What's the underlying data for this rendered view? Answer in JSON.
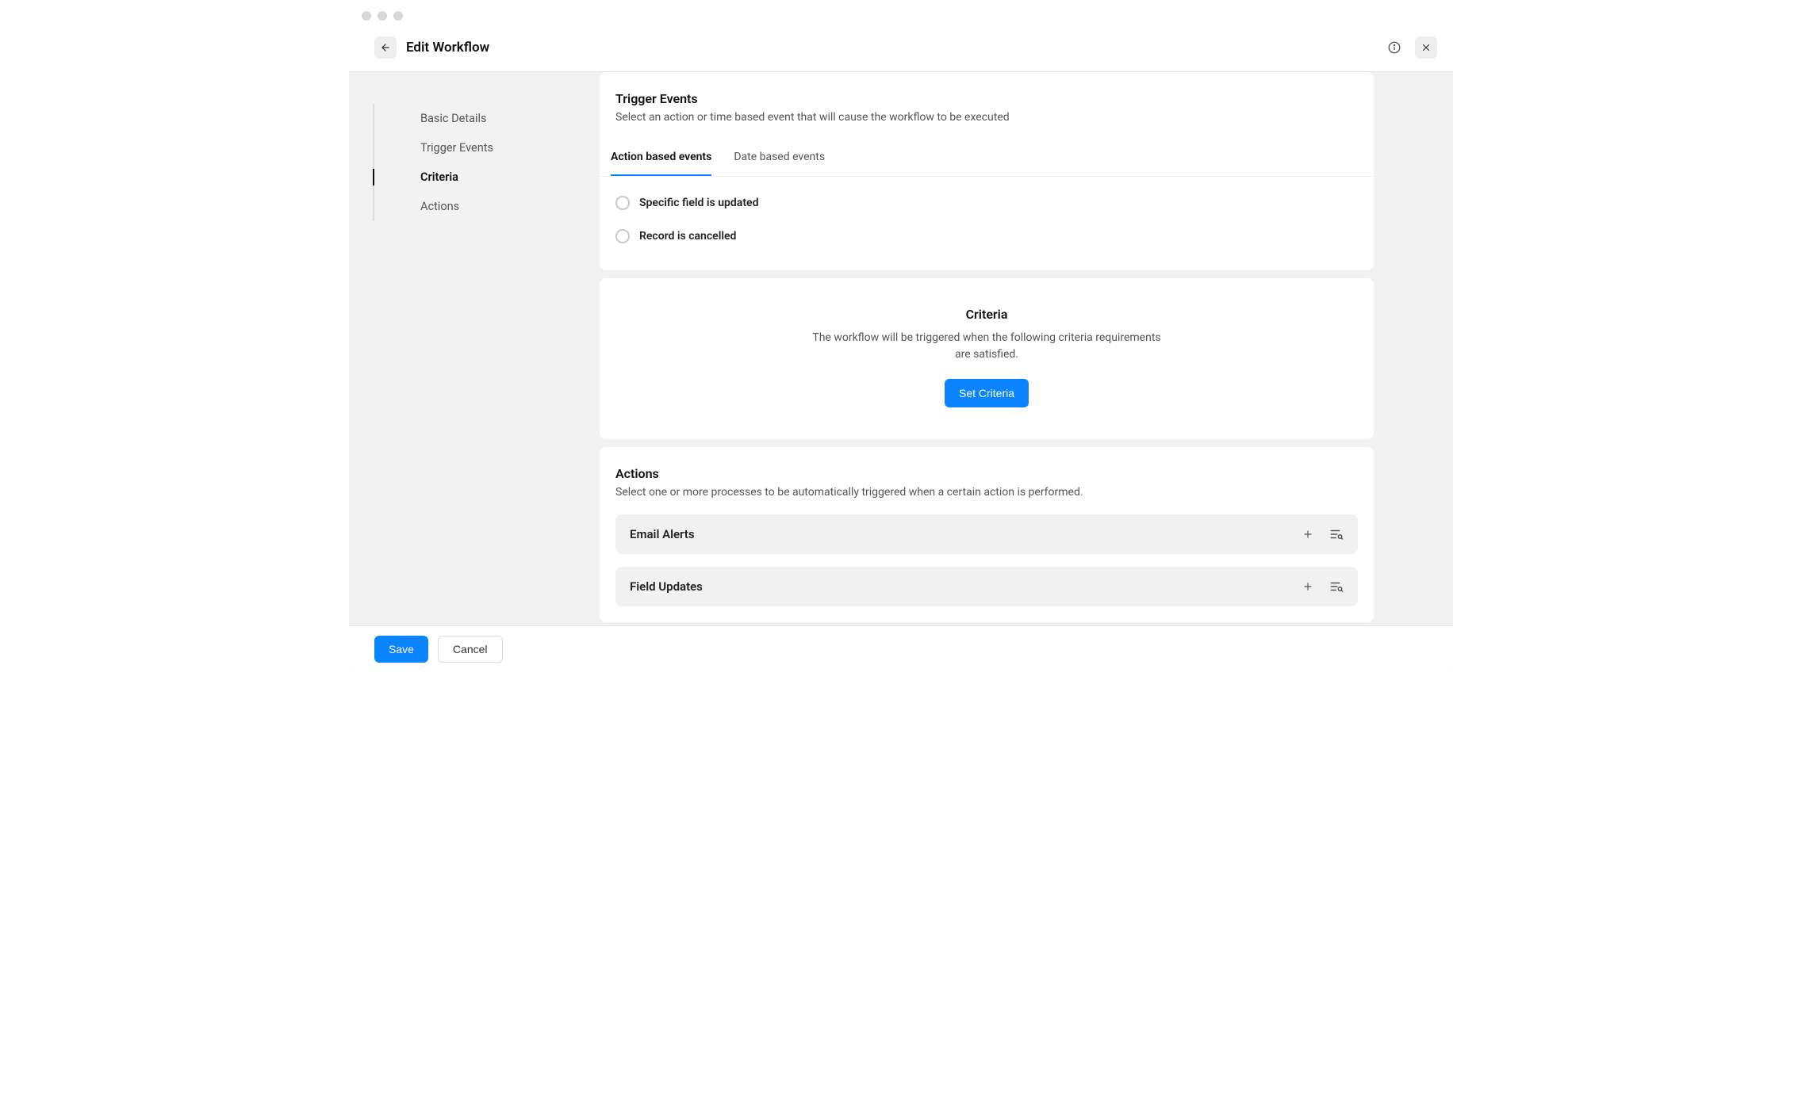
{
  "header": {
    "title": "Edit Workflow"
  },
  "sidebar": {
    "items": [
      {
        "label": "Basic Details"
      },
      {
        "label": "Trigger Events"
      },
      {
        "label": "Criteria"
      },
      {
        "label": "Actions"
      }
    ]
  },
  "trigger": {
    "title": "Trigger Events",
    "subtitle": "Select an action or time based event that will cause the workflow to be executed",
    "tabs": [
      {
        "label": "Action based events"
      },
      {
        "label": "Date based events"
      }
    ],
    "options": [
      {
        "label": "Specific field is updated"
      },
      {
        "label": "Record is cancelled"
      }
    ]
  },
  "criteria": {
    "title": "Criteria",
    "subtitle": "The workflow will be triggered when the following criteria requirements are satisfied.",
    "button": "Set Criteria"
  },
  "actions": {
    "title": "Actions",
    "subtitle": "Select one or more processes to be automatically triggered when a certain action is performed.",
    "items": [
      {
        "label": "Email Alerts"
      },
      {
        "label": "Field Updates"
      }
    ]
  },
  "footer": {
    "save": "Save",
    "cancel": "Cancel"
  }
}
